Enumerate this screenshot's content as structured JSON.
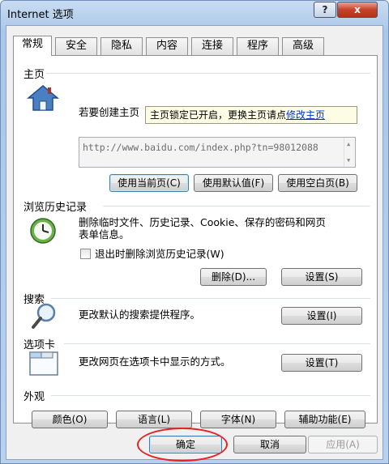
{
  "window": {
    "title": "Internet 选项",
    "help_glyph": "?",
    "close_glyph": "x"
  },
  "tabs": [
    {
      "label": "常规",
      "active": true
    },
    {
      "label": "安全"
    },
    {
      "label": "隐私"
    },
    {
      "label": "内容"
    },
    {
      "label": "连接"
    },
    {
      "label": "程序"
    },
    {
      "label": "高级"
    }
  ],
  "home": {
    "section": "主页",
    "intro": "若要创建主页",
    "tooltip_text": "主页锁定已开启，更换主页请点",
    "tooltip_link": "修改主页",
    "url": "http://www.baidu.com/index.php?tn=98012088",
    "btn_current": "使用当前页(C)",
    "btn_default": "使用默认值(F)",
    "btn_blank": "使用空白页(B)"
  },
  "history": {
    "section": "浏览历史记录",
    "desc_line1": "删除临时文件、历史记录、Cookie、保存的密码和网页",
    "desc_line2": "表单信息。",
    "checkbox_label": "退出时删除浏览历史记录(W)",
    "btn_delete": "删除(D)...",
    "btn_settings": "设置(S)"
  },
  "search": {
    "section": "搜索",
    "desc": "更改默认的搜索提供程序。",
    "btn_settings": "设置(I)"
  },
  "tabsec": {
    "section": "选项卡",
    "desc": "更改网页在选项卡中显示的方式。",
    "btn_settings": "设置(T)"
  },
  "appearance": {
    "section": "外观",
    "btn_colors": "颜色(O)",
    "btn_languages": "语言(L)",
    "btn_fonts": "字体(N)",
    "btn_accessibility": "辅助功能(E)"
  },
  "footer": {
    "ok": "确定",
    "cancel": "取消",
    "apply": "应用(A)"
  },
  "colors": {
    "accent_red": "#e52320",
    "link_blue": "#0033cc",
    "tooltip_bg": "#fdfde6"
  },
  "icons": [
    "house-icon",
    "clock-globe-icon",
    "magnifier-icon",
    "tab-window-icon"
  ]
}
